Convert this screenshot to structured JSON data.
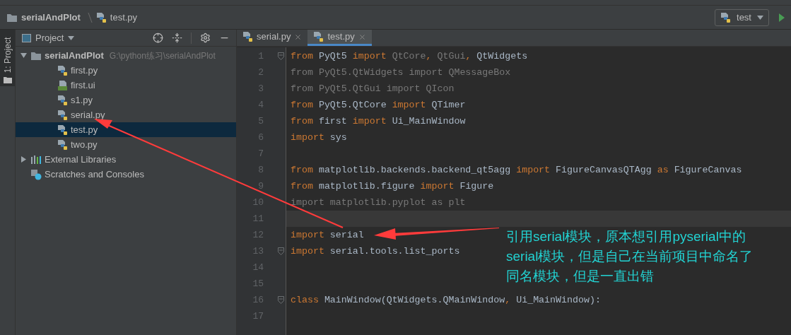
{
  "breadcrumb": [
    {
      "label": "serialAndPlot",
      "kind": "folder"
    },
    {
      "label": "test.py",
      "kind": "python"
    }
  ],
  "run_config": {
    "label": "test"
  },
  "side_tab": {
    "label": "1: Project",
    "selected": true
  },
  "project_panel": {
    "title": "Project",
    "tree": [
      {
        "label": "serialAndPlot",
        "hint": "G:\\python练习\\serialAndPlot",
        "kind": "folder",
        "expanded": true,
        "selected": false,
        "children": [
          {
            "label": "first.py",
            "kind": "python",
            "selected": false
          },
          {
            "label": "first.ui",
            "kind": "qt",
            "selected": false
          },
          {
            "label": "s1.py",
            "kind": "python",
            "selected": false
          },
          {
            "label": "serial.py",
            "kind": "python",
            "selected": false
          },
          {
            "label": "test.py",
            "kind": "python",
            "selected": true
          },
          {
            "label": "two.py",
            "kind": "python",
            "selected": false
          }
        ]
      },
      {
        "label": "External Libraries",
        "kind": "libraries",
        "expanded": false,
        "selected": false
      },
      {
        "label": "Scratches and Consoles",
        "kind": "scratches",
        "selected": false
      }
    ]
  },
  "editor": {
    "tabs": [
      {
        "label": "serial.py",
        "selected": false
      },
      {
        "label": "test.py",
        "selected": true
      }
    ],
    "lines": [
      {
        "number": "1",
        "fold": true,
        "current": false,
        "tokens": [
          {
            "text": "from",
            "kind": "keyword"
          },
          {
            "text": " PyQt5 ",
            "kind": "plain"
          },
          {
            "text": "import",
            "kind": "keyword"
          },
          {
            "text": " QtCore",
            "kind": "unused"
          },
          {
            "text": ",",
            "kind": "keyword"
          },
          {
            "text": " QtGui",
            "kind": "unused"
          },
          {
            "text": ",",
            "kind": "keyword"
          },
          {
            "text": " QtWidgets",
            "kind": "plain"
          }
        ]
      },
      {
        "number": "2",
        "fold": false,
        "current": false,
        "tokens": [
          {
            "text": "from PyQt5.QtWidgets import QMessageBox",
            "kind": "unused"
          }
        ]
      },
      {
        "number": "3",
        "fold": false,
        "current": false,
        "tokens": [
          {
            "text": "from PyQt5.QtGui import QIcon",
            "kind": "unused"
          }
        ]
      },
      {
        "number": "4",
        "fold": false,
        "current": false,
        "tokens": [
          {
            "text": "from",
            "kind": "keyword"
          },
          {
            "text": " PyQt5.QtCore ",
            "kind": "plain"
          },
          {
            "text": "import",
            "kind": "keyword"
          },
          {
            "text": " QTimer",
            "kind": "plain"
          }
        ]
      },
      {
        "number": "5",
        "fold": false,
        "current": false,
        "tokens": [
          {
            "text": "from",
            "kind": "keyword"
          },
          {
            "text": " first ",
            "kind": "plain"
          },
          {
            "text": "import",
            "kind": "keyword"
          },
          {
            "text": " Ui_MainWindow",
            "kind": "plain"
          }
        ]
      },
      {
        "number": "6",
        "fold": false,
        "current": false,
        "tokens": [
          {
            "text": "import",
            "kind": "keyword"
          },
          {
            "text": " sys",
            "kind": "plain"
          }
        ]
      },
      {
        "number": "7",
        "fold": false,
        "current": false
      },
      {
        "number": "8",
        "fold": false,
        "current": false,
        "tokens": [
          {
            "text": "from",
            "kind": "keyword"
          },
          {
            "text": " matplotlib.backends.backend_qt5agg ",
            "kind": "plain"
          },
          {
            "text": "import",
            "kind": "keyword"
          },
          {
            "text": " FigureCanvasQTAgg ",
            "kind": "plain"
          },
          {
            "text": "as",
            "kind": "keyword"
          },
          {
            "text": " FigureCanvas",
            "kind": "plain"
          }
        ]
      },
      {
        "number": "9",
        "fold": false,
        "current": false,
        "tokens": [
          {
            "text": "from",
            "kind": "keyword"
          },
          {
            "text": " matplotlib.figure ",
            "kind": "plain"
          },
          {
            "text": "import",
            "kind": "keyword"
          },
          {
            "text": " Figure",
            "kind": "plain"
          }
        ]
      },
      {
        "number": "10",
        "fold": false,
        "current": false,
        "tokens": [
          {
            "text": "import matplotlib.pyplot as plt",
            "kind": "unused"
          }
        ]
      },
      {
        "number": "11",
        "fold": false,
        "current": true
      },
      {
        "number": "12",
        "fold": false,
        "current": false,
        "tokens": [
          {
            "text": "import",
            "kind": "keyword"
          },
          {
            "text": " serial",
            "kind": "plain"
          }
        ]
      },
      {
        "number": "13",
        "fold": true,
        "current": false,
        "tokens": [
          {
            "text": "import",
            "kind": "keyword"
          },
          {
            "text": " serial.tools.list_ports",
            "kind": "plain"
          }
        ]
      },
      {
        "number": "14",
        "fold": false,
        "current": false
      },
      {
        "number": "15",
        "fold": false,
        "current": false
      },
      {
        "number": "16",
        "fold": true,
        "current": false,
        "tokens": [
          {
            "text": "class",
            "kind": "keyword"
          },
          {
            "text": " MainWindow(QtWidgets.QMainWindow",
            "kind": "plain"
          },
          {
            "text": ",",
            "kind": "keyword"
          },
          {
            "text": " Ui_MainWindow):",
            "kind": "plain"
          }
        ]
      },
      {
        "number": "17",
        "fold": false,
        "current": false
      }
    ]
  },
  "annotation": {
    "text": "引用serial模块，原本想引用pyserial中的serial模块，但是自己在当前项目中命名了同名模块，但是一直出错"
  }
}
